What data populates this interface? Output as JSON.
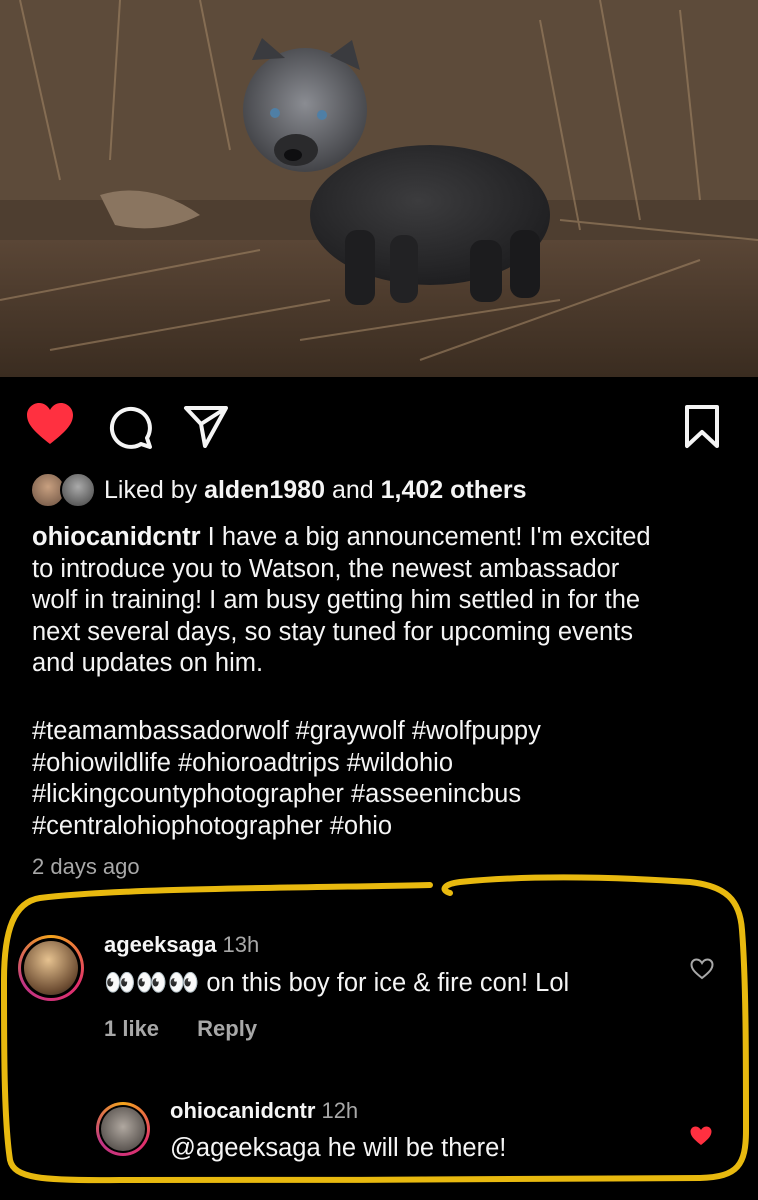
{
  "post": {
    "liked_by_prefix": "Liked by ",
    "liked_by_user": "alden1980",
    "liked_by_mid": " and ",
    "liked_by_others": "1,402 others",
    "caption_user": "ohiocanidcntr",
    "caption_text": " I have a big announcement! I'm excited\nto introduce you to Watson, the newest ambassador\nwolf in training! I am busy getting him settled in for the\nnext several days, so stay tuned for upcoming events\nand updates on him.",
    "hashtags": "#teamambassadorwolf #graywolf #wolfpuppy\n#ohiowildlife #ohioroadtrips #wildohio\n#lickingcountyphotographer #asseenincbus\n#centralohiophotographer #ohio",
    "time_ago": "2 days ago",
    "liked": true
  },
  "icons": {
    "like": "heart-filled-icon",
    "comment": "comment-bubble-icon",
    "share": "paper-plane-icon",
    "save": "bookmark-icon"
  },
  "comments": [
    {
      "user": "ageeksaga",
      "time": "13h",
      "emoji": "👀👀👀",
      "text": " on this boy for ice & fire con! Lol",
      "likes_label": "1 like",
      "reply_label": "Reply",
      "liked": false
    },
    {
      "user": "ohiocanidcntr",
      "time": "12h",
      "text": "@ageeksaga he will be there!",
      "liked": true
    }
  ],
  "colors": {
    "heart_red": "#ff3040",
    "highlight_yellow": "#e8b90f",
    "muted_text": "#a8a8a8"
  }
}
